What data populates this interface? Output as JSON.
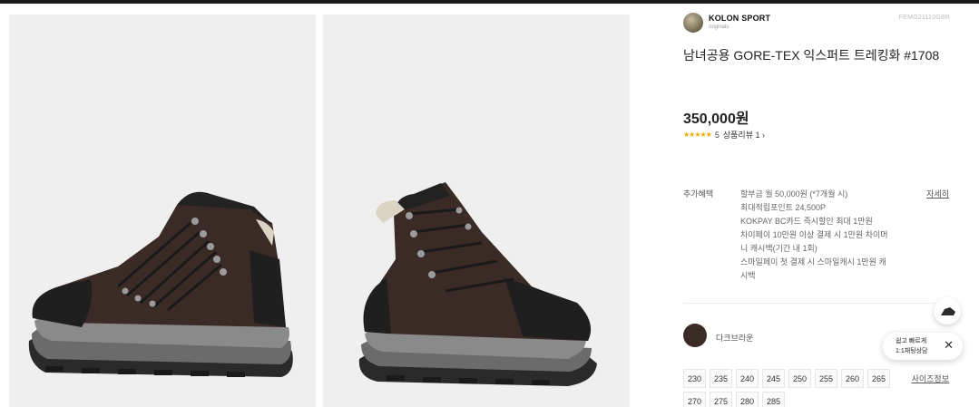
{
  "brand": {
    "name": "KOLON SPORT",
    "sub": "originals",
    "product_code": "FEMG21110GBR"
  },
  "product": {
    "title": "남녀공용 GORE-TEX 익스퍼트 트레킹화 #1708",
    "price": "350,000원",
    "stars": "★★★★★",
    "rating_count": "5",
    "review_label": "상품리뷰 1 ›"
  },
  "benefits": {
    "label": "추가혜택",
    "detail_label": "자세히",
    "lines": [
      "할부금 월 50,000원 (*7개월 시)",
      "최대적립포인트 24,500P",
      "KOKPAY BC카드 즉시할인 최대 1만원",
      "차이페이 10만원 이상 결제 시 1만원 차이머",
      "니 캐시백(기간 내 1회)",
      "스마일페이 첫 결제 시 스마일캐시 1만원 캐",
      "시백"
    ]
  },
  "color": {
    "name": "다크브라운",
    "hex": "#3b2b26"
  },
  "sizes": [
    "230",
    "235",
    "240",
    "245",
    "250",
    "255",
    "260",
    "265",
    "270",
    "275",
    "280",
    "285"
  ],
  "size_guide_label": "사이즈정보",
  "chat": {
    "line1": "쉽고 빠르게",
    "line2": "1:1채팅상담",
    "close": "✕"
  }
}
